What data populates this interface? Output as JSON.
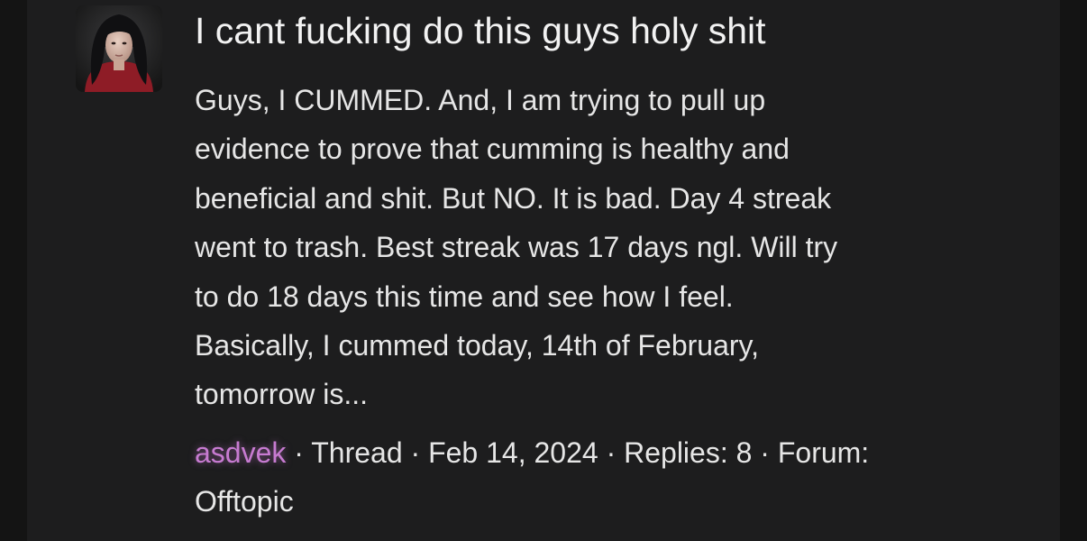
{
  "thread": {
    "title": "I cant fucking do this guys holy shit",
    "snippet_lines": [
      "Guys, I CUMMED. And, I am trying to pull up",
      "evidence to prove that cumming is healthy and",
      "beneficial and shit. But NO. It is bad. Day 4 streak",
      "went to trash. Best streak was 17 days ngl. Will try",
      "to do 18 days this time and see how I feel.",
      "Basically, I cummed today, 14th of February,",
      "tomorrow is..."
    ],
    "author": "asdvek",
    "sep": " · ",
    "type": "Thread",
    "date": "Feb 14, 2024",
    "replies_label": "Replies:",
    "replies_count": "8",
    "forum_label": "Forum:",
    "forum_name": "Offtopic"
  },
  "colors": {
    "background": "#141414",
    "panel": "#1d1d1e",
    "text": "#e6e6e6",
    "username": "#c77bd1"
  },
  "icons": {
    "avatar": "user-avatar-photo"
  }
}
